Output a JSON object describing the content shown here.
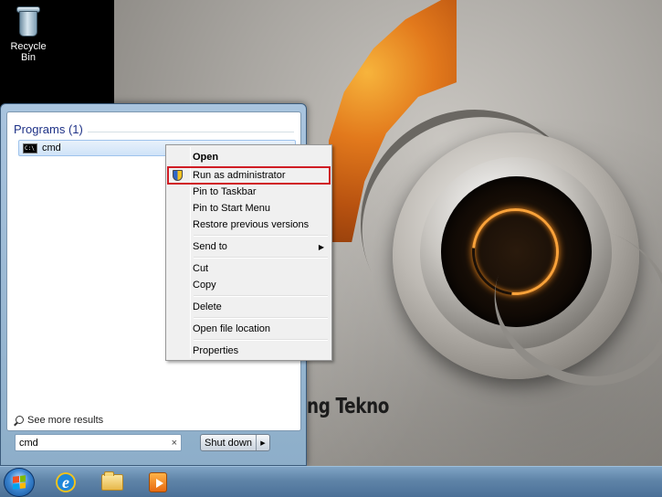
{
  "desktop": {
    "icons": [
      {
        "label": "Recycle Bin",
        "icon": "recycle-bin-icon"
      }
    ],
    "wallpaper_text": "ng Tekno"
  },
  "start_menu": {
    "section_title": "Programs (1)",
    "results": [
      {
        "label": "cmd",
        "icon": "command-prompt-icon"
      }
    ],
    "see_more_label": "See more results",
    "search": {
      "value": "cmd",
      "clear_icon": "×"
    },
    "shutdown_label": "Shut down",
    "shutdown_arrow": "▶"
  },
  "context_menu": {
    "items": [
      {
        "label": "Open",
        "bold": true
      },
      {
        "label": "Run as administrator",
        "icon": "uac-shield-icon",
        "highlighted": true
      },
      {
        "label": "Pin to Taskbar"
      },
      {
        "label": "Pin to Start Menu"
      },
      {
        "label": "Restore previous versions"
      },
      {
        "label": "Send to",
        "submenu": true
      },
      {
        "label": "Cut"
      },
      {
        "label": "Copy"
      },
      {
        "label": "Delete"
      },
      {
        "label": "Open file location"
      },
      {
        "label": "Properties"
      }
    ],
    "submenu_arrow": "▶",
    "highlight_color": "#d01c24"
  },
  "taskbar": {
    "pinned": [
      {
        "name": "internet-explorer",
        "glyph": "e"
      },
      {
        "name": "windows-explorer"
      },
      {
        "name": "windows-media-player"
      }
    ]
  }
}
